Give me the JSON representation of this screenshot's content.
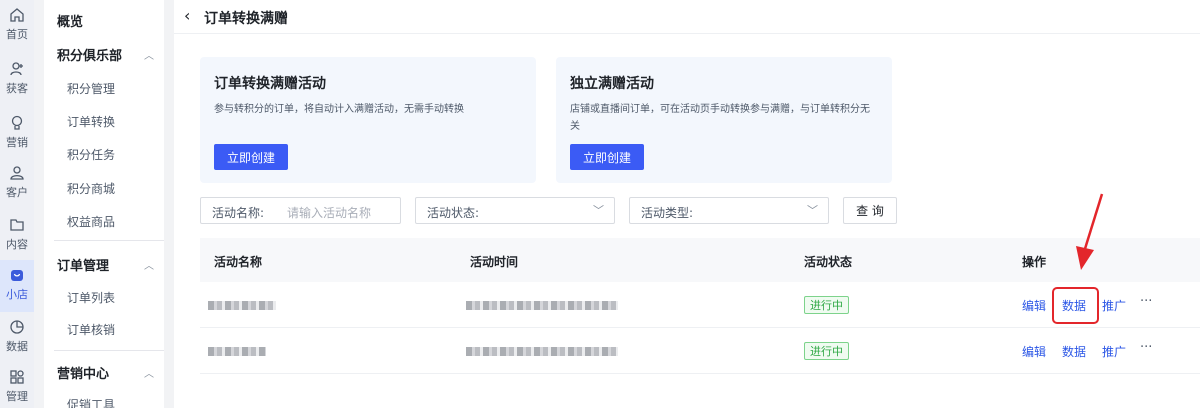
{
  "rail": [
    {
      "label": "首页",
      "icon": "home-icon"
    },
    {
      "label": "获客",
      "icon": "user-add-icon"
    },
    {
      "label": "营销",
      "icon": "bulb-icon"
    },
    {
      "label": "客户",
      "icon": "user-icon"
    },
    {
      "label": "内容",
      "icon": "folder-icon"
    },
    {
      "label": "小店",
      "icon": "shop-icon"
    },
    {
      "label": "数据",
      "icon": "pie-chart-icon"
    },
    {
      "label": "管理",
      "icon": "grid-icon"
    }
  ],
  "menu": {
    "overview": "概览",
    "group1": "积分俱乐部",
    "group1_items": [
      "积分管理",
      "订单转换",
      "积分任务",
      "积分商城",
      "权益商品"
    ],
    "group2": "订单管理",
    "group2_items": [
      "订单列表",
      "订单核销"
    ],
    "group3": "营销中心",
    "group3_items": [
      "促销工具"
    ]
  },
  "header": {
    "title": "订单转换满赠"
  },
  "cards": [
    {
      "title": "订单转换满赠活动",
      "desc": "参与转积分的订单，将自动计入满赠活动，无需手动转换",
      "button": "立即创建"
    },
    {
      "title": "独立满赠活动",
      "desc_line1": "店铺或直播间订单，可在活动页手动转换参与满赠，与订单转积分无",
      "desc_line2": "关",
      "button": "立即创建"
    }
  ],
  "filters": {
    "name_label": "活动名称:",
    "name_placeholder": "请输入活动名称",
    "status_label": "活动状态:",
    "type_label": "活动类型:",
    "query_button": "查 询"
  },
  "table": {
    "columns": [
      "活动名称",
      "活动时间",
      "活动状态",
      "操作"
    ],
    "rows": [
      {
        "status": "进行中",
        "actions": [
          "编辑",
          "数据",
          "推广",
          "···"
        ]
      },
      {
        "status": "进行中",
        "actions": [
          "编辑",
          "数据",
          "推广",
          "···"
        ]
      }
    ]
  },
  "colors": {
    "accent": "#3b5bf5",
    "link": "#2b56e6",
    "status_green": "#2fa845",
    "highlight": "#e3262b"
  }
}
